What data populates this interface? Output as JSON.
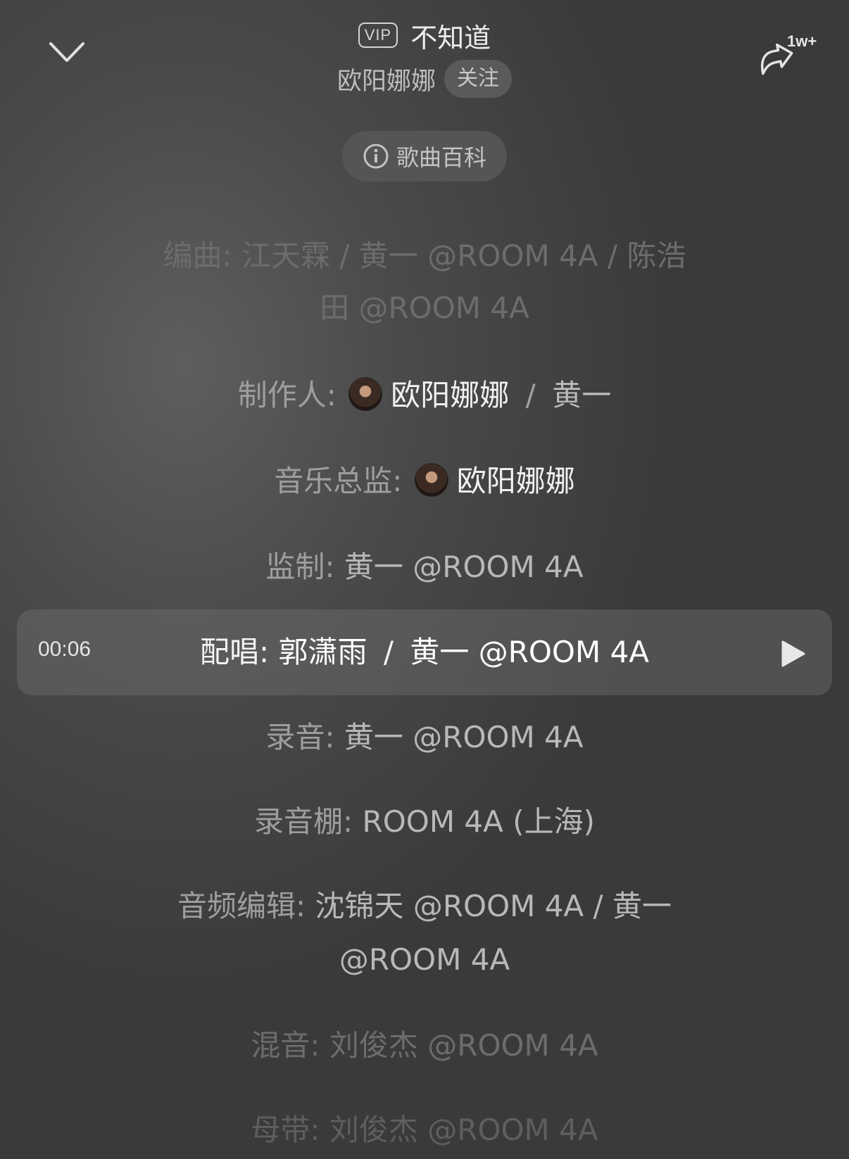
{
  "header": {
    "vip_badge": "VIP",
    "song_title": "不知道",
    "artist": "欧阳娜娜",
    "follow_label": "关注",
    "share_count": "1w+",
    "wiki_label": "歌曲百科"
  },
  "credits": {
    "arranger": {
      "label": "编曲:",
      "line1": "江天霖 / 黄一 @ROOM 4A / 陈浩",
      "line2": "田 @ROOM 4A"
    },
    "producer": {
      "label": "制作人:",
      "name1": "欧阳娜娜",
      "sep": "/",
      "name2": "黄一"
    },
    "music_director": {
      "label": "音乐总监:",
      "name": "欧阳娜娜"
    },
    "supervisor": {
      "label": "监制:",
      "value": "黄一 @ROOM 4A"
    },
    "backing_vocals": {
      "label": "配唱:",
      "name1": "郭潇雨",
      "sep": "/",
      "name2": "黄一 @ROOM 4A"
    },
    "recording": {
      "label": "录音:",
      "value": "黄一 @ROOM 4A"
    },
    "studio": {
      "label": "录音棚:",
      "value": "ROOM 4A (上海)"
    },
    "audio_editing": {
      "label": "音频编辑:",
      "line1": "沈锦天 @ROOM 4A / 黄一",
      "line2": "@ROOM 4A"
    },
    "mixing": {
      "label": "混音:",
      "value": "刘俊杰 @ROOM 4A"
    },
    "master": {
      "label": "母带:",
      "value": "刘俊杰 @ROOM 4A"
    }
  },
  "player": {
    "current_time": "00:06"
  },
  "colors": {
    "background": "#4a4a4a",
    "highlight": "#ffffff",
    "faded": "#6c6c6c"
  }
}
